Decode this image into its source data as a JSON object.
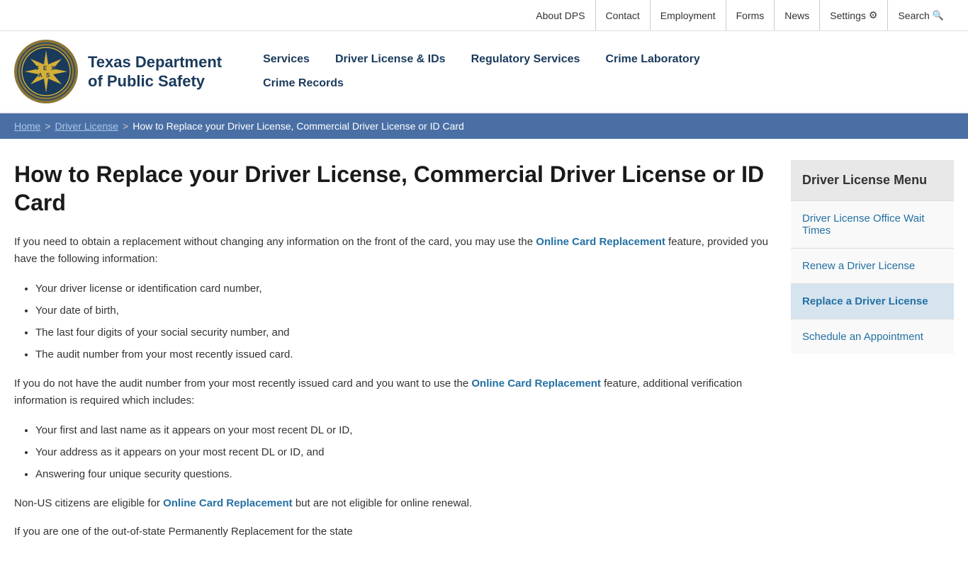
{
  "topbar": {
    "links": [
      {
        "id": "about-dps",
        "label": "About DPS"
      },
      {
        "id": "contact",
        "label": "Contact"
      },
      {
        "id": "employment",
        "label": "Employment"
      },
      {
        "id": "forms",
        "label": "Forms"
      },
      {
        "id": "news",
        "label": "News"
      },
      {
        "id": "settings",
        "label": "Settings"
      },
      {
        "id": "search",
        "label": "Search"
      }
    ]
  },
  "header": {
    "org_name_line1": "Texas Department",
    "org_name_line2": "of Public Safety"
  },
  "nav": {
    "row1": [
      {
        "id": "services",
        "label": "Services"
      },
      {
        "id": "driver-license-ids",
        "label": "Driver License & IDs"
      },
      {
        "id": "regulatory-services",
        "label": "Regulatory Services"
      },
      {
        "id": "crime-laboratory",
        "label": "Crime Laboratory"
      }
    ],
    "row2": [
      {
        "id": "crime-records",
        "label": "Crime Records"
      }
    ]
  },
  "breadcrumb": {
    "home": "Home",
    "driver_license": "Driver License",
    "current": "How to Replace your Driver License, Commercial Driver License or ID Card"
  },
  "page": {
    "title": "How to Replace your Driver License, Commercial Driver License or ID Card",
    "intro1": "If you need to obtain a replacement without changing any information on the front of the card, you may use the",
    "online_card_replacement_link": "Online Card Replacement",
    "intro1_rest": "feature, provided you have the following information:",
    "list1": [
      "Your driver license or identification card number,",
      "Your date of birth,",
      "The last four digits of your social security number, and",
      "The audit number from your most recently issued card."
    ],
    "para2_before": "If you do not have the audit number from your most recently issued card and you want to use the",
    "online_card_replacement_link2": "Online Card Replacement",
    "para2_after": "feature, additional verification information is required which includes:",
    "list2": [
      "Your first and last name as it appears on your most recent DL or ID,",
      "Your address as it appears on your most recent DL or ID, and",
      "Answering four unique security questions."
    ],
    "para3_before": "Non-US citizens are eligible for",
    "online_card_replacement_link3": "Online Card Replacement",
    "para3_after": "but are not eligible for online renewal.",
    "para4_before": "If you are one of the out-of-state Permanently Replacement for the state"
  },
  "sidebar": {
    "menu_title": "Driver License Menu",
    "items": [
      {
        "id": "wait-times",
        "label": "Driver License Office Wait Times",
        "active": false
      },
      {
        "id": "renew",
        "label": "Renew a Driver License",
        "active": false
      },
      {
        "id": "replace",
        "label": "Replace a Driver License",
        "active": true
      },
      {
        "id": "appointment",
        "label": "Schedule an Appointment",
        "active": false
      }
    ]
  }
}
